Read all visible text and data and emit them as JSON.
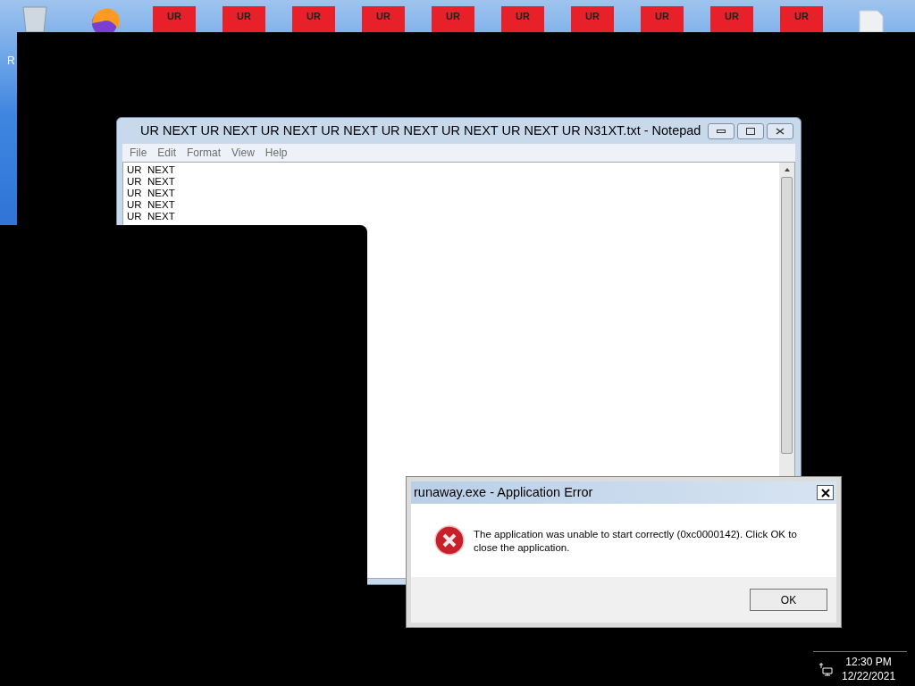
{
  "desktop": {
    "recycle_bin_label": "R",
    "shortcuts": [
      "UR",
      "UR",
      "UR",
      "UR",
      "UR",
      "UR",
      "UR",
      "UR",
      "UR",
      "UR"
    ]
  },
  "notepad": {
    "title": "UR NEXT UR NEXT UR NEXT UR NEXT UR NEXT UR NEXT UR NEXT UR N31XT.txt - Notepad",
    "menu": [
      "File",
      "Edit",
      "Format",
      "View",
      "Help"
    ],
    "lines": [
      "UR  NEXT",
      "UR  NEXT",
      "UR  NEXT",
      "UR  NEXT",
      "UR  NEXT"
    ]
  },
  "dialog": {
    "title": "runaway.exe - Application Error",
    "message": "The application was unable to start correctly (0xc0000142). Click OK to close the application.",
    "buttons": [
      "OK"
    ]
  },
  "tray": {
    "time": "12:30 PM",
    "date": "12/22/2021"
  }
}
